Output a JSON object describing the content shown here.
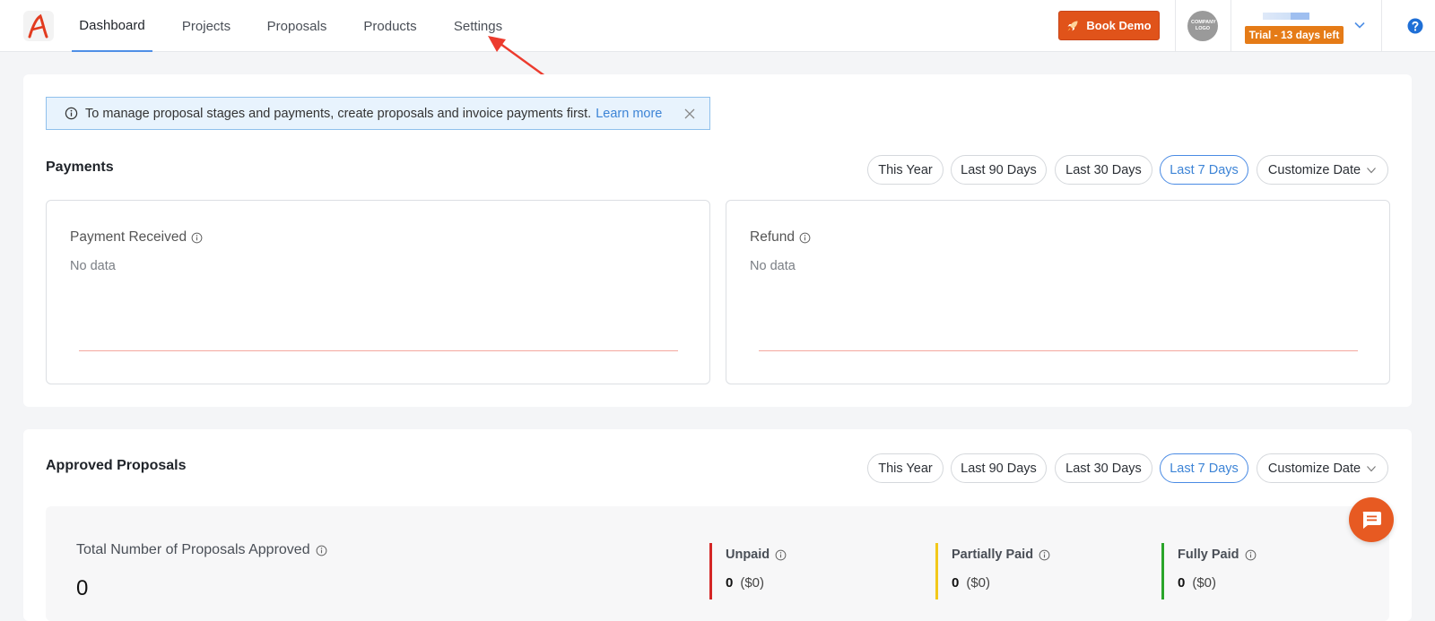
{
  "nav": {
    "tabs": [
      {
        "label": "Dashboard",
        "active": true
      },
      {
        "label": "Projects"
      },
      {
        "label": "Proposals"
      },
      {
        "label": "Products"
      },
      {
        "label": "Settings"
      }
    ],
    "book_demo": "Book Demo",
    "company_logo_text": "COMPANY LOGO",
    "trial": "Trial - 13 days left"
  },
  "banner": {
    "text": "To manage proposal stages and payments, create proposals and invoice payments first.",
    "link": "Learn more"
  },
  "payments": {
    "title": "Payments",
    "filters": [
      "This Year",
      "Last 90 Days",
      "Last 30 Days",
      "Last 7 Days",
      "Customize Date"
    ],
    "active_filter": "Last 7 Days",
    "received": {
      "label": "Payment Received",
      "status": "No data"
    },
    "refund": {
      "label": "Refund",
      "status": "No data"
    }
  },
  "approved": {
    "title": "Approved Proposals",
    "filters": [
      "This Year",
      "Last 90 Days",
      "Last 30 Days",
      "Last 7 Days",
      "Customize Date"
    ],
    "active_filter": "Last 7 Days",
    "total_label": "Total Number of Proposals Approved",
    "total_value": "0",
    "stats": [
      {
        "label": "Unpaid",
        "count": "0",
        "amount": "($0)",
        "color": "#d42626"
      },
      {
        "label": "Partially Paid",
        "count": "0",
        "amount": "($0)",
        "color": "#f2c81a"
      },
      {
        "label": "Fully Paid",
        "count": "0",
        "amount": "($0)",
        "color": "#2aa52a"
      }
    ]
  },
  "colors": {
    "accent": "#e0531a",
    "link": "#3d84d6",
    "trial": "#e57b17"
  }
}
